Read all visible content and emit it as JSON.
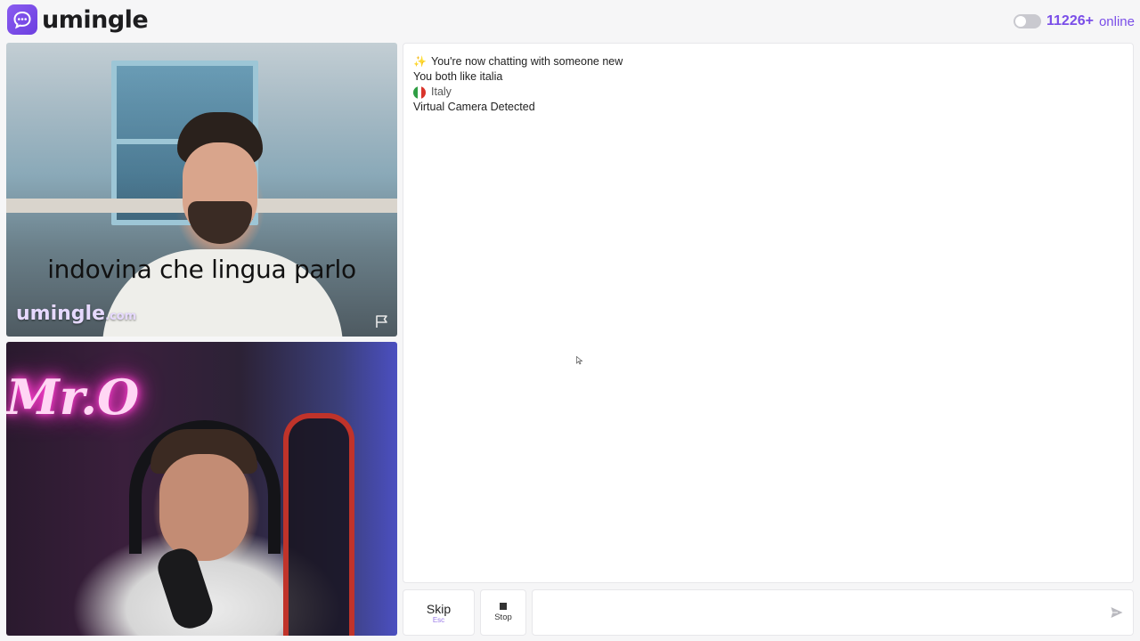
{
  "header": {
    "logo_text": "umingle",
    "online_count": "11226+",
    "online_label": "online"
  },
  "stranger_video": {
    "caption": "indovina che lingua parlo",
    "watermark_main": "umingle",
    "watermark_domain": ".com"
  },
  "self_video": {
    "neon_sign": "Mr.O"
  },
  "chat": {
    "messages": [
      "You're now chatting with someone new",
      "You both like italia",
      "Italy",
      "Virtual Camera Detected"
    ]
  },
  "controls": {
    "skip_label": "Skip",
    "skip_key": "Esc",
    "stop_label": "Stop",
    "message_placeholder": ""
  },
  "colors": {
    "brand": "#7a4ee8",
    "flag_green": "#2f9e44",
    "flag_white": "#ffffff",
    "flag_red": "#d9342b"
  }
}
